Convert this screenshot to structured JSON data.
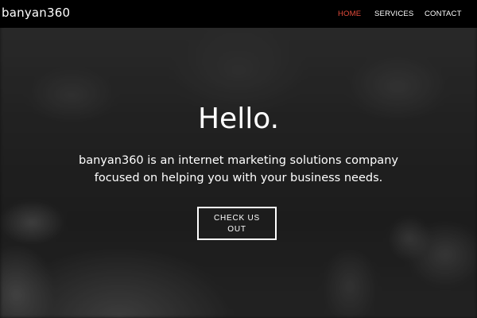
{
  "navbar": {
    "brand": "banyan360",
    "links": [
      {
        "label": "HOME",
        "active": true
      },
      {
        "label": "SERVICES",
        "active": false
      },
      {
        "label": "CONTACT",
        "active": false
      }
    ],
    "background_color": "#000000",
    "active_color": "#e74c3c"
  },
  "hero": {
    "title": "Hello.",
    "text_line_1": "banyan360 is an internet marketing solutions company",
    "text_line_2": "focused on helping you with your business needs.",
    "cta_label": "CHECK US OUT",
    "background": "grayscale blurred crowd photo"
  }
}
